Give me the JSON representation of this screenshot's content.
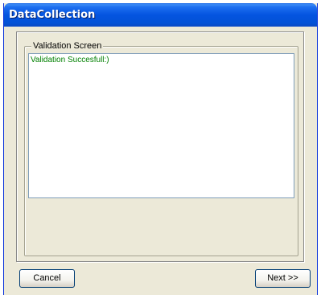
{
  "window": {
    "title": "DataCollection"
  },
  "group": {
    "legend": "Validation Screen"
  },
  "status": {
    "message": "Validation Succesfull:)"
  },
  "buttons": {
    "cancel_label": "Cancel",
    "next_label": "Next >>"
  },
  "colors": {
    "titlebar": "#0454e0",
    "window_bg": "#ece9d8",
    "message_text": "#008000"
  }
}
